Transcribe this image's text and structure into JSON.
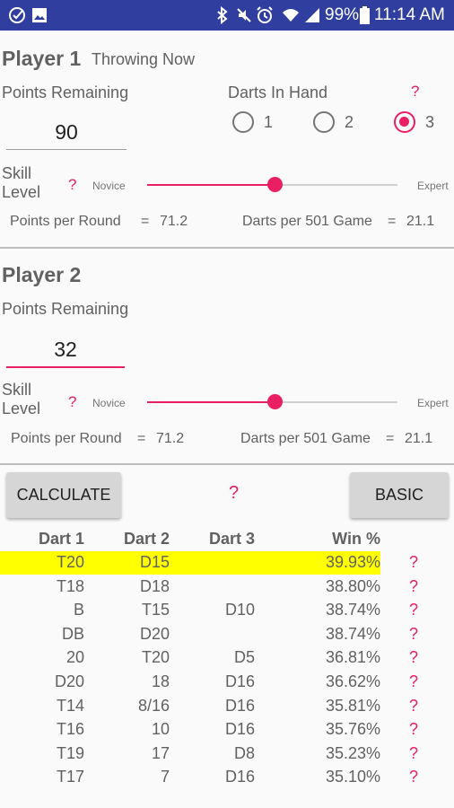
{
  "status_bar": {
    "battery": "99%",
    "time": "11:14 AM",
    "icons": [
      "check-circle-icon",
      "image-icon",
      "bluetooth-icon",
      "mute-icon",
      "alarm-icon",
      "wifi-icon",
      "signal-icon",
      "battery-icon"
    ]
  },
  "colors": {
    "accent": "#e91e63",
    "status_bar": "#303f9f",
    "highlight": "#ffff00"
  },
  "player1": {
    "name": "Player 1",
    "status": "Throwing Now",
    "points_label": "Points Remaining",
    "points_value": "90",
    "darts_label": "Darts In Hand",
    "help": "?",
    "darts_options": [
      "1",
      "2",
      "3"
    ],
    "darts_selected": "3",
    "skill_label": "Skill Level",
    "skill_novice": "Novice",
    "skill_expert": "Expert",
    "skill_level": 0.51,
    "ppr_label": "Points per Round",
    "ppr_eq": "=",
    "ppr_value": "71.2",
    "dpg_label": "Darts per 501 Game",
    "dpg_eq": "=",
    "dpg_value": "21.1"
  },
  "player2": {
    "name": "Player 2",
    "points_label": "Points Remaining",
    "points_value": "32",
    "skill_label": "Skill Level",
    "help": "?",
    "skill_novice": "Novice",
    "skill_expert": "Expert",
    "skill_level": 0.51,
    "ppr_label": "Points per Round",
    "ppr_eq": "=",
    "ppr_value": "71.2",
    "dpg_label": "Darts per 501 Game",
    "dpg_eq": "=",
    "dpg_value": "21.1"
  },
  "buttons": {
    "calculate": "CALCULATE",
    "help": "?",
    "basic": "BASIC"
  },
  "table": {
    "headers": [
      "Dart 1",
      "Dart 2",
      "Dart 3",
      "Win %"
    ],
    "rows": [
      {
        "d1": "T20",
        "d2": "D15",
        "d3": "",
        "win": "39.93%",
        "help": "?"
      },
      {
        "d1": "T18",
        "d2": "D18",
        "d3": "",
        "win": "38.80%",
        "help": "?"
      },
      {
        "d1": "B",
        "d2": "T15",
        "d3": "D10",
        "win": "38.74%",
        "help": "?"
      },
      {
        "d1": "DB",
        "d2": "D20",
        "d3": "",
        "win": "38.74%",
        "help": "?"
      },
      {
        "d1": "20",
        "d2": "T20",
        "d3": "D5",
        "win": "36.81%",
        "help": "?"
      },
      {
        "d1": "D20",
        "d2": "18",
        "d3": "D16",
        "win": "36.62%",
        "help": "?"
      },
      {
        "d1": "T14",
        "d2": "8/16",
        "d3": "D16",
        "win": "35.81%",
        "help": "?"
      },
      {
        "d1": "T16",
        "d2": "10",
        "d3": "D16",
        "win": "35.76%",
        "help": "?"
      },
      {
        "d1": "T19",
        "d2": "17",
        "d3": "D8",
        "win": "35.23%",
        "help": "?"
      },
      {
        "d1": "T17",
        "d2": "7",
        "d3": "D16",
        "win": "35.10%",
        "help": "?"
      }
    ],
    "highlighted_row": 0
  }
}
